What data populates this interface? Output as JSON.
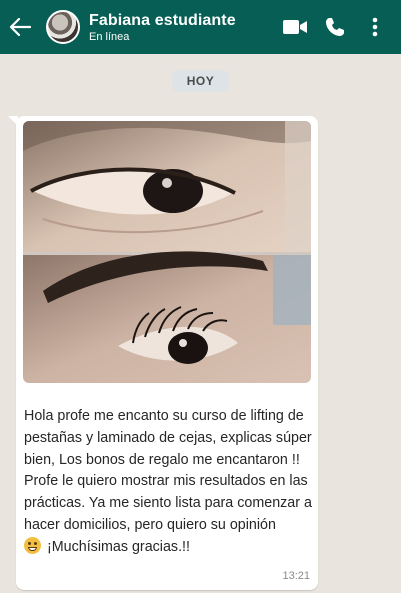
{
  "header": {
    "contact_name": "Fabiana estudiante",
    "contact_status": "En línea",
    "bg_color": "#075e54"
  },
  "icons": {
    "back": "arrow-left-icon",
    "video": "video-call-icon",
    "phone": "phone-icon",
    "menu": "more-vertical-icon"
  },
  "chat": {
    "date_label": "HOY",
    "message": {
      "text": "Hola profe me encanto su curso de lifting de pestañas y laminado de cejas, explicas súper bien, Los bonos de regalo me encantaron !! Profe le quiero mostrar mis resultados en las prácticas. Ya me siento lista para comenzar a hacer domicilios, pero quiero su opinión",
      "text_end": "¡Muchísimas gracias.!!",
      "emoji": "grinning-face-emoji",
      "time": "13:21"
    }
  }
}
